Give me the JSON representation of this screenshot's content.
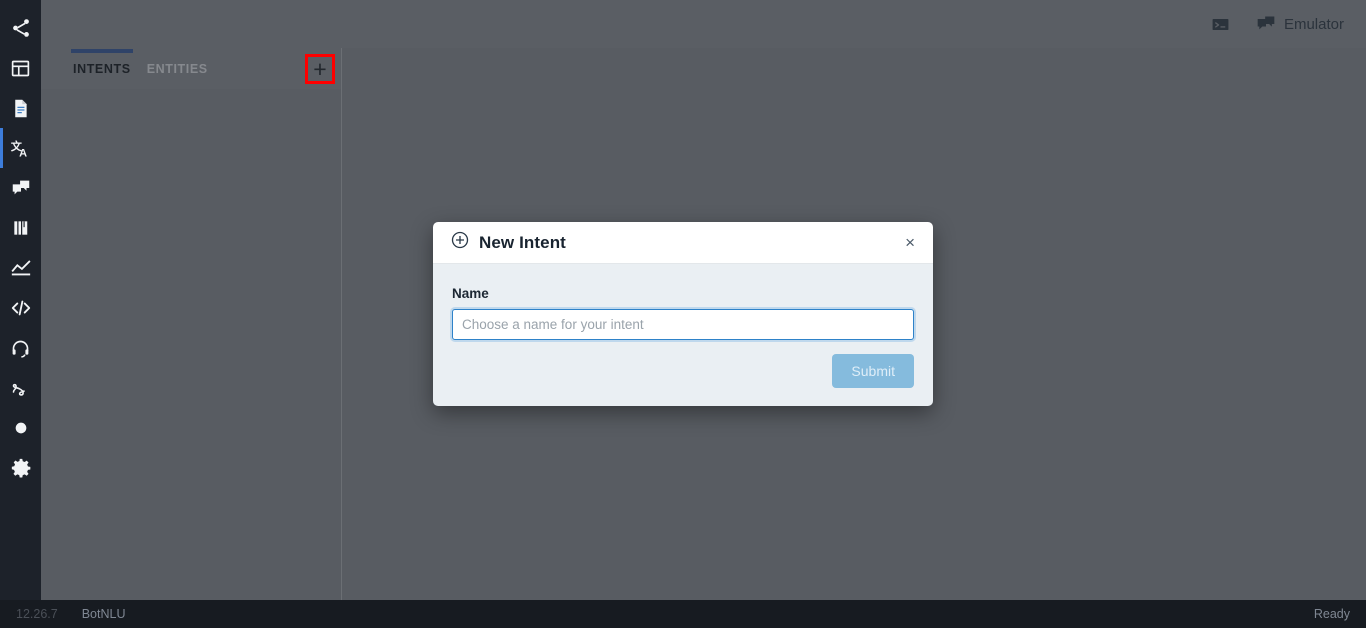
{
  "rail": {
    "items": [
      {
        "name": "share-icon",
        "label": "Share",
        "active": false
      },
      {
        "name": "layout-icon",
        "label": "Layout",
        "active": false
      },
      {
        "name": "document-icon",
        "label": "Document",
        "active": false
      },
      {
        "name": "translate-icon",
        "label": "NLU",
        "active": true
      },
      {
        "name": "chat-icon",
        "label": "Chat",
        "active": false
      },
      {
        "name": "book-icon",
        "label": "Knowledge",
        "active": false
      },
      {
        "name": "chart-icon",
        "label": "Analytics",
        "active": false
      },
      {
        "name": "code-icon",
        "label": "Code",
        "active": false
      },
      {
        "name": "headset-icon",
        "label": "Support",
        "active": false
      },
      {
        "name": "flow-icon",
        "label": "Flows",
        "active": false
      },
      {
        "name": "circle-icon",
        "label": "Record",
        "active": false
      },
      {
        "name": "gear-icon",
        "label": "Settings",
        "active": false
      }
    ]
  },
  "topbar": {
    "terminal_icon": "terminal-icon",
    "emulator_icon": "chat-bubbles-icon",
    "emulator_label": "Emulator"
  },
  "tabs": [
    {
      "label": "INTENTS",
      "active": true
    },
    {
      "label": "ENTITIES",
      "active": false
    }
  ],
  "add_button": {
    "glyph": "+",
    "name": "add-intent-button",
    "highlight_color": "#fe0000"
  },
  "modal": {
    "icon": "circle-plus-icon",
    "title": "New Intent",
    "close_glyph": "×",
    "field": {
      "label": "Name",
      "value": "",
      "placeholder": "Choose a name for your intent"
    },
    "submit_label": "Submit",
    "submit_disabled": true,
    "accent_color": "#2e82c9",
    "submit_color": "#85bbdd"
  },
  "statusbar": {
    "version": "12.26.7",
    "project": "BotNLU",
    "status": "Ready"
  }
}
